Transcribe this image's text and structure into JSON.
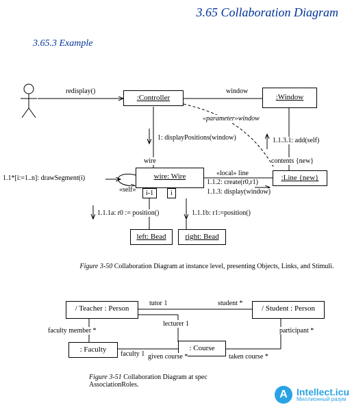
{
  "page": {
    "title": "3.65  Collaboration Diagram",
    "subtitle": "3.65.3  Example"
  },
  "diagram1": {
    "controller": ":Controller",
    "window": ":Window",
    "wire": "wire: Wire",
    "line": ":Line {new}",
    "left_bead": "left: Bead",
    "right_bead": "right: Bead",
    "qual_left": "i-1",
    "qual_right": "i",
    "redisplay": "redisplay()",
    "window_assoc": "window",
    "param_window": "«parameter»window",
    "wire_assoc": "wire",
    "self_label": "«self»",
    "msg_display_positions": "1: displayPositions(window)",
    "msg_draw_segment": "1.1*[i:=1..n]: drawSegment(i)",
    "msg_r0": "1.1.1a: r0 := position()",
    "msg_r1": "1.1.1b: r1:=position()",
    "msg_create": "1.1.2: create(r0,r1)",
    "msg_display": "1.1.3: display(window)",
    "msg_add": "1.1.3.1: add(self)",
    "contents_new": "contents {new}",
    "local_line": "«local» line"
  },
  "diagram2": {
    "teacher": "/ Teacher : Person",
    "student": "/ Student : Person",
    "faculty": ": Faculty",
    "course": ": Course",
    "tutor": "tutor 1",
    "student_mult": "student *",
    "faculty_member": "faculty member *",
    "faculty_one": "faculty 1",
    "lecturer": "lecturer 1",
    "given_course": "given course *",
    "taken_course": "taken course *",
    "participant": "participant *"
  },
  "captions": {
    "fig1_num": "Figure 3-50",
    "fig1_text": "  Collaboration Diagram at instance level, presenting Objects, Links, and Stimuli.",
    "fig2_num": "Figure 3-51",
    "fig2_text_a": "  Collaboration Diagram at spec",
    "fig2_text_b": "AssociationRoles."
  },
  "watermark": {
    "glyph": "A",
    "main": "Intellect.icu",
    "sub": "Миллионный разум"
  }
}
